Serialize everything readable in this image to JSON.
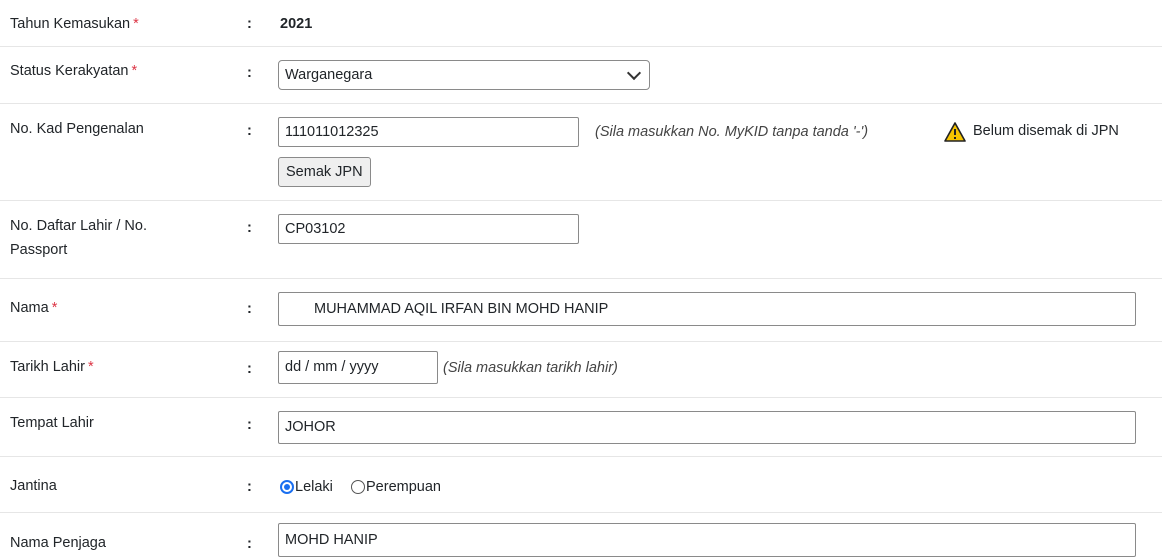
{
  "fields": {
    "tahun": {
      "label": "Tahun Kemasukan",
      "required": "*",
      "value": "2021"
    },
    "status": {
      "label": "Status Kerakyatan",
      "required": "*",
      "selected": "Warganegara"
    },
    "ic": {
      "label": "No. Kad Pengenalan",
      "value": "111011012325",
      "hint": "(Sila masukkan No. MyKID tanpa tanda '-')",
      "button": "Semak JPN",
      "status_text": "Belum disemak di JPN"
    },
    "daftar": {
      "label_line1": "No. Daftar Lahir / No.",
      "label_line2": "Passport",
      "value": "CP03102"
    },
    "nama": {
      "label": "Nama",
      "required": "*",
      "value": "MUHAMMAD AQIL IRFAN BIN MOHD HANIP"
    },
    "tarikh": {
      "label": "Tarikh Lahir",
      "required": "*",
      "placeholder": "dd / mm / yyyy",
      "hint": "(Sila masukkan tarikh lahir)"
    },
    "tempat": {
      "label": "Tempat Lahir",
      "value": "JOHOR"
    },
    "jantina": {
      "label": "Jantina",
      "option_male": "Lelaki",
      "option_female": "Perempuan",
      "selected": "Lelaki"
    },
    "penjaga": {
      "label": "Nama Penjaga",
      "value": "MOHD HANIP"
    }
  },
  "colon": ":",
  "colors": {
    "required": "#dc3545",
    "radio_accent": "#1a6ff0",
    "warning": "#f5c400"
  },
  "icons": {
    "warning": "warning-triangle-icon",
    "select_arrow": "chevron-down-icon"
  }
}
